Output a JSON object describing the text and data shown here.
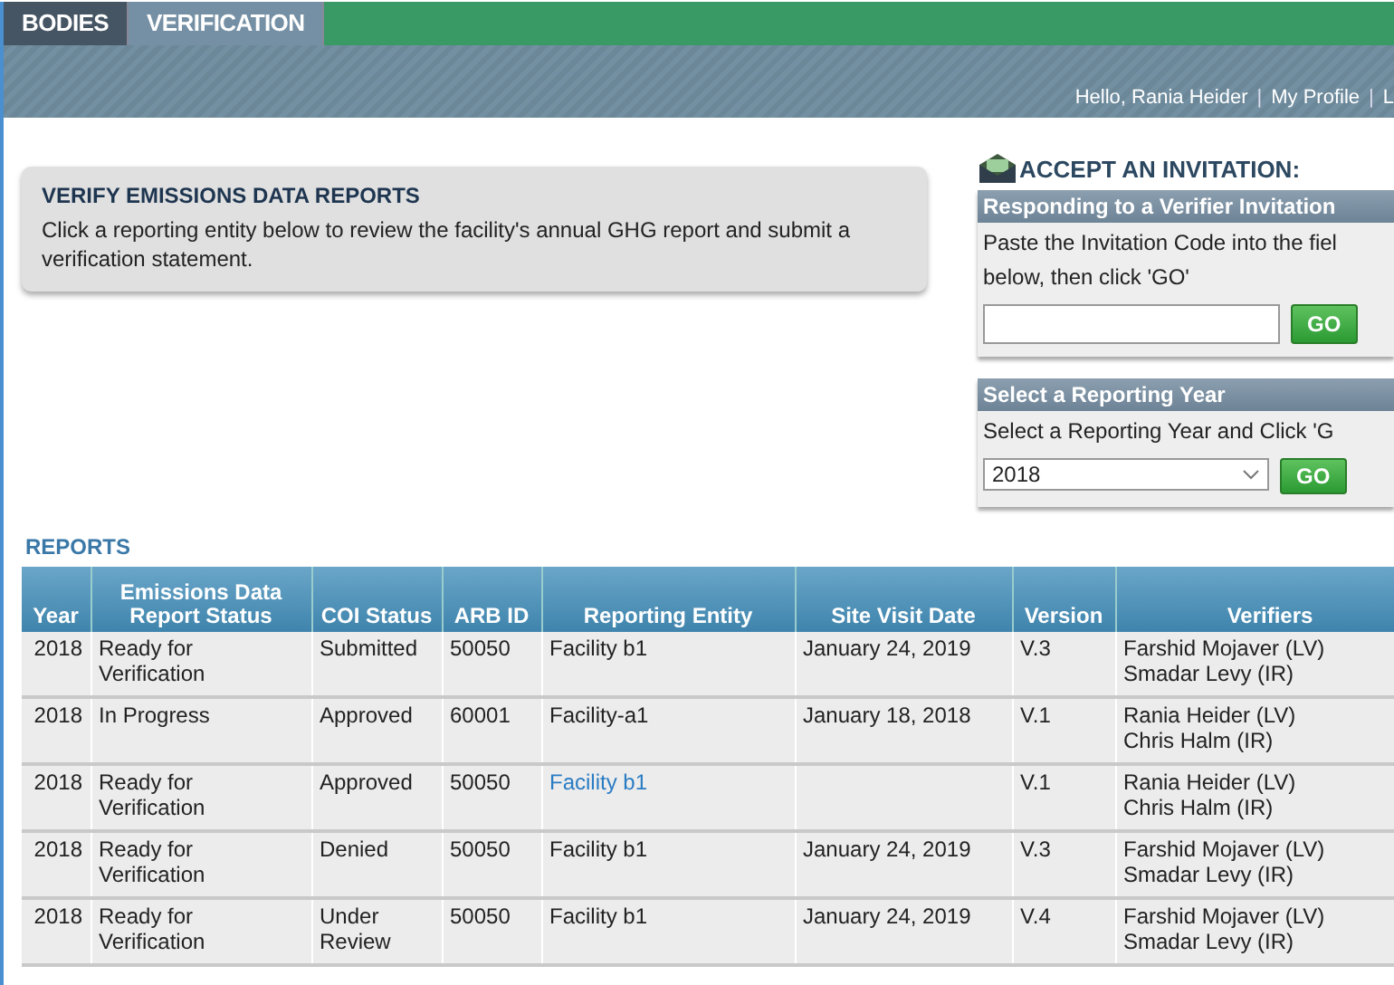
{
  "nav_tabs": [
    {
      "label": "BODIES",
      "selected": false
    },
    {
      "label": "VERIFICATION",
      "selected": true
    }
  ],
  "user_bar": {
    "greeting": "Hello, Rania Heider",
    "links": [
      {
        "separator": "|",
        "label": "My Profile"
      },
      {
        "separator": "|",
        "label": "L"
      }
    ]
  },
  "intro": {
    "title": "VERIFY EMISSIONS DATA REPORTS",
    "text": "Click a reporting entity below to review the facility's annual GHG report and submit a verification statement."
  },
  "invitation": {
    "title": "ACCEPT AN INVITATION:",
    "header": "Responding to a Verifier Invitation",
    "text": "Paste the Invitation Code into the fiel",
    "text_2": "below, then click 'GO'",
    "button": "GO"
  },
  "year_panel": {
    "header": "Select a Reporting Year",
    "text": "Select a Reporting Year and Click 'G",
    "value": "2018",
    "button": "GO"
  },
  "reports": {
    "title": "REPORTS",
    "columns": [
      "Year",
      "Emissions Data Report Status",
      "COI Status",
      "ARB ID",
      "Reporting Entity",
      "Site Visit Date",
      "Version",
      "Verifiers"
    ],
    "rows": [
      {
        "year": "2018",
        "status": "Ready for Verification",
        "coi": "Submitted",
        "arb_id": "50050",
        "entity": "Facility b1",
        "entity_link": false,
        "date": "January 24, 2019",
        "version": "V.3",
        "verifiers": [
          "Farshid Mojaver (LV)",
          "Smadar Levy (IR)"
        ]
      },
      {
        "year": "2018",
        "status": "In Progress",
        "coi": "Approved",
        "arb_id": "60001",
        "entity": "Facility-a1",
        "entity_link": false,
        "date": "January 18, 2018",
        "version": "V.1",
        "verifiers": [
          "Rania Heider (LV)",
          "Chris Halm (IR)"
        ]
      },
      {
        "year": "2018",
        "status": "Ready for Verification",
        "coi": "Approved",
        "arb_id": "50050",
        "entity": "Facility b1",
        "entity_link": true,
        "version": "V.1",
        "verifiers": [
          "Rania Heider (LV)",
          "Chris Halm (IR)"
        ]
      },
      {
        "year": "2018",
        "status": "Ready for Verification",
        "coi": "Denied",
        "arb_id": "50050",
        "entity": "Facility b1",
        "entity_link": false,
        "date": "January 24, 2019",
        "version": "V.3",
        "verifiers": [
          "Farshid Mojaver (LV)",
          "Smadar Levy (IR)"
        ]
      },
      {
        "year": "2018",
        "status": "Ready for Verification",
        "coi": "Under Review",
        "arb_id": "50050",
        "entity": "Facility b1",
        "entity_link": false,
        "date": "January 24, 2019",
        "version": "V.4",
        "verifiers": [
          "Farshid Mojaver (LV)",
          "Smadar Levy (IR)"
        ]
      }
    ]
  }
}
